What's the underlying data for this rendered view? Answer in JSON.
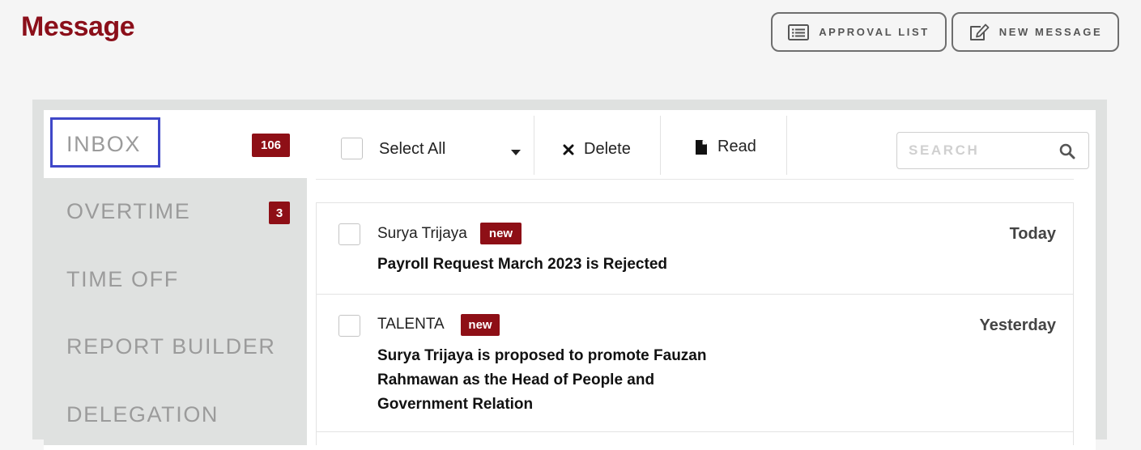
{
  "page": {
    "title": "Message"
  },
  "actions": {
    "approval_list": "APPROVAL LIST",
    "new_message": "NEW MESSAGE"
  },
  "sidebar": {
    "items": [
      {
        "label": "INBOX",
        "badge": "106",
        "selected": true
      },
      {
        "label": "OVERTIME",
        "badge": "3"
      },
      {
        "label": "TIME OFF"
      },
      {
        "label": "REPORT BUILDER"
      },
      {
        "label": "DELEGATION"
      }
    ]
  },
  "toolbar": {
    "select_all": "Select All",
    "delete": "Delete",
    "read": "Read"
  },
  "search": {
    "placeholder": "SEARCH",
    "value": ""
  },
  "messages": [
    {
      "sender": "Surya Trijaya",
      "badge": "new",
      "subject": "Payroll Request March 2023 is Rejected",
      "date": "Today"
    },
    {
      "sender": "TALENTA",
      "badge": "new",
      "subject_lines": [
        "Surya Trijaya is proposed to promote Fauzan",
        "Rahmawan as the Head of People and",
        "Government Relation"
      ],
      "date": "Yesterday"
    }
  ],
  "colors": {
    "brand": "#8b0f1a",
    "badge": "#8e0f16",
    "selection_outline": "#3f47c8",
    "sidebar_bg": "#dfe1e0",
    "page_bg": "#f5f5f5"
  }
}
